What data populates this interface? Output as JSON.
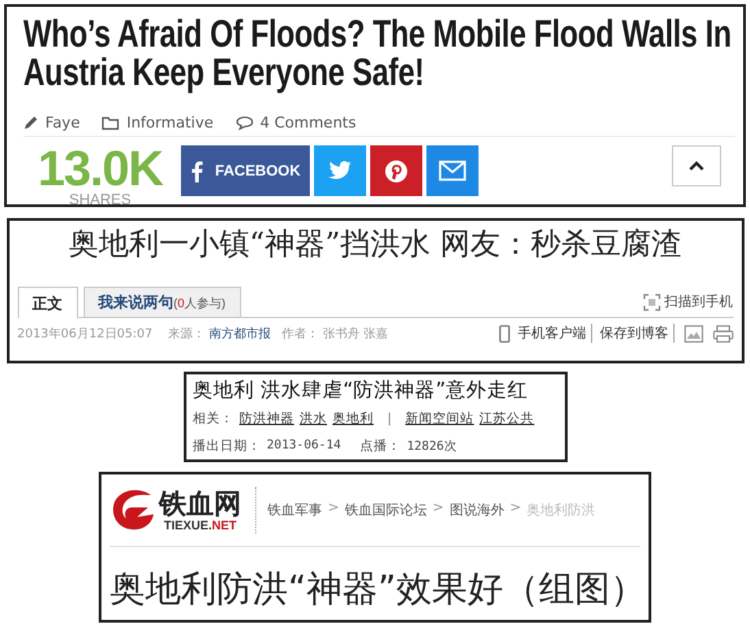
{
  "article_en": {
    "title": "Who’s Afraid Of Floods? The Mobile Flood Walls In Austria Keep Everyone Safe!",
    "meta": [
      {
        "kind": "author",
        "text": "Faye"
      },
      {
        "kind": "category",
        "text": "Informative"
      },
      {
        "kind": "comments",
        "text": "4 Comments"
      }
    ],
    "shares": {
      "count": "13.0K",
      "label": "SHARES"
    },
    "share_buttons": [
      {
        "kind": "facebook",
        "label": "FACEBOOK"
      },
      {
        "kind": "twitter"
      },
      {
        "kind": "pinterest"
      },
      {
        "kind": "email"
      }
    ]
  },
  "news_article": {
    "title": "奥地利一小镇“神器”挡洪水  网友：秒杀豆腐渣",
    "tabs": [
      {
        "label": "正文",
        "selected": true
      },
      {
        "label": "我来说两句",
        "note_open": "(",
        "note_count": "0",
        "note_rest": "人参与)",
        "selected": false
      }
    ],
    "scan_link": "扫描到手机",
    "date": "2013年06月12日05:07",
    "source_label": "来源：",
    "source": "南方都市报",
    "author_label": "作者：",
    "authors": "张书舟 张嘉",
    "actions": [
      "手机客户端",
      "保存到博客"
    ]
  },
  "video": {
    "title": "奥地利 洪水肆虐“防洪神器”意外走红",
    "related_label": "相关：",
    "tags": [
      "防洪神器",
      "洪水",
      "奥地利"
    ],
    "separator": "|",
    "channels": [
      "新闻空间站",
      "江苏公共"
    ],
    "air_date_label": "播出日期：",
    "air_date": "2013-06-14",
    "plays_label": "点播：",
    "plays": "12826次"
  },
  "forum": {
    "logo_text": "铁血网",
    "logo_sub_main": "TIEXUE.",
    "logo_sub_accent": "NET",
    "breadcrumbs": [
      {
        "kind": "link",
        "label": "铁血军事"
      },
      {
        "kind": "separator",
        "label": ">"
      },
      {
        "kind": "link",
        "label": "铁血国际论坛"
      },
      {
        "kind": "separator",
        "label": ">"
      },
      {
        "kind": "link",
        "label": "图说海外"
      },
      {
        "kind": "separator",
        "label": ">"
      },
      {
        "kind": "current",
        "label": "奥地利防洪"
      }
    ],
    "title": "奥地利防洪“神器”效果好（组图）"
  }
}
